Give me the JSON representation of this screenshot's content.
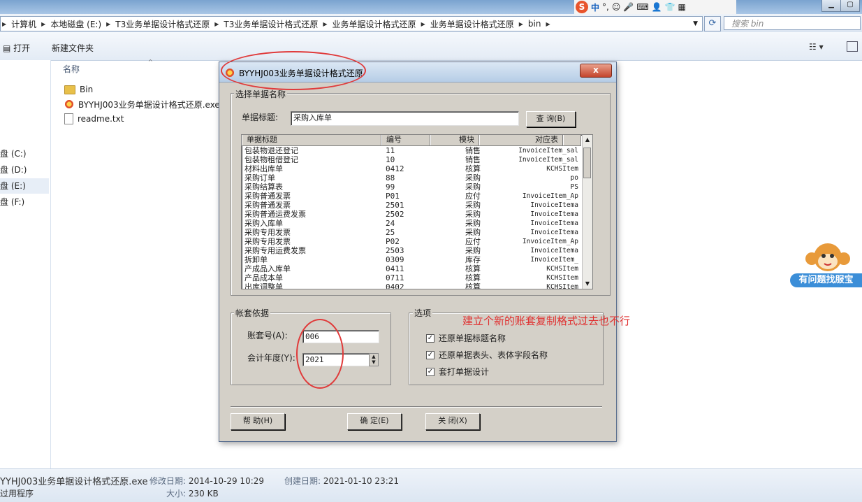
{
  "breadcrumb": [
    "计算机",
    "本地磁盘 (E:)",
    "T3业务单据设计格式还原",
    "T3业务单据设计格式还原",
    "业务单据设计格式还原",
    "业务单据设计格式还原",
    "bin"
  ],
  "search": {
    "placeholder": "搜索 bin"
  },
  "ime": {
    "brand": "S",
    "mode": "中"
  },
  "toolbar": {
    "open": "打开",
    "new_folder": "新建文件夹"
  },
  "file_list": {
    "column_name": "名称",
    "items": [
      {
        "name": "Bin",
        "type": "folder"
      },
      {
        "name": "BYYHJ003业务单据设计格式还原.exe",
        "type": "exe"
      },
      {
        "name": "readme.txt",
        "type": "txt"
      }
    ]
  },
  "nav": {
    "drives": [
      "盘 (C:)",
      "盘 (D:)",
      "盘 (E:)",
      "盘 (F:)"
    ]
  },
  "status": {
    "filename": "YYHJ003业务单据设计格式还原.exe",
    "modified_label": "修改日期:",
    "modified": "2014-10-29 10:29",
    "created_label": "创建日期:",
    "created": "2021-01-10 23:21",
    "type": "过用程序",
    "size_label": "大小:",
    "size": "230 KB"
  },
  "service": {
    "label": "有问题找服宝"
  },
  "dialog": {
    "title": "BYYHJ003业务单据设计格式还原",
    "close": "x",
    "select_group": "选择单据名称",
    "doc_title_label": "单据标题:",
    "doc_title_value": "采购入库单",
    "query_button": "查 询(B)",
    "columns": [
      "单据标题",
      "编号",
      "模块",
      "对应表"
    ],
    "rows": [
      [
        "包装物退还登记",
        "11",
        "销售",
        "InvoiceItem_sal"
      ],
      [
        "包装物租借登记",
        "10",
        "销售",
        "InvoiceItem_sal"
      ],
      [
        "材料出库单",
        "0412",
        "核算",
        "KCHSItem"
      ],
      [
        "采购订单",
        "88",
        "采购",
        "po"
      ],
      [
        "采购结算表",
        "99",
        "采购",
        "PS"
      ],
      [
        "采购普通发票",
        "P01",
        "应付",
        "InvoiceItem_Ap"
      ],
      [
        "采购普通发票",
        "2501",
        "采购",
        "InvoiceItema"
      ],
      [
        "采购普通运费发票",
        "2502",
        "采购",
        "InvoiceItema"
      ],
      [
        "采购入库单",
        "24",
        "采购",
        "InvoiceItema"
      ],
      [
        "采购专用发票",
        "25",
        "采购",
        "InvoiceItema"
      ],
      [
        "采购专用发票",
        "P02",
        "应付",
        "InvoiceItem_Ap"
      ],
      [
        "采购专用运费发票",
        "2503",
        "采购",
        "InvoiceItema"
      ],
      [
        "拆卸单",
        "0309",
        "库存",
        "InvoiceItem_"
      ],
      [
        "产成品入库单",
        "0411",
        "核算",
        "KCHSItem"
      ],
      [
        "产品成本单",
        "0711",
        "核算",
        "KCHSItem"
      ],
      [
        "出库调整单",
        "0402",
        "核算",
        "KCHSItem"
      ]
    ],
    "account_group": "帐套依据",
    "account_label": "账套号(A):",
    "account_value": "006",
    "year_label": "会计年度(Y):",
    "year_value": "2021",
    "options_group": "选项",
    "options": [
      "还原单据标题名称",
      "还原单据表头、表体字段名称",
      "套打单据设计"
    ],
    "help_button": "帮 助(H)",
    "ok_button": "确 定(E)",
    "close_button": "关 闭(X)"
  },
  "annotation": {
    "note": "建立个新的账套复制格式过去也不行",
    "color": "#e03030"
  }
}
